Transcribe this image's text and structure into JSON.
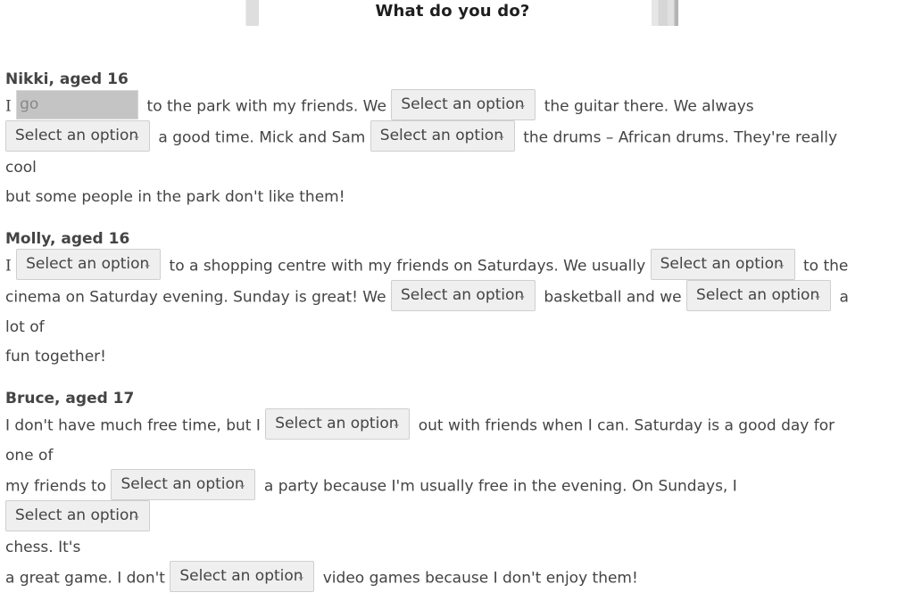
{
  "header": {
    "title": "What do you do?"
  },
  "select_placeholder": "Select an option",
  "sections": [
    {
      "name": "Nikki, aged 16",
      "parts": {
        "t0": "I",
        "input_value": "go",
        "t1": "to the park with my friends. We",
        "t2": "the guitar there. We always",
        "t3": "a good time. Mick and Sam",
        "t4": "the drums – African drums. They're really cool",
        "t5": "but some people in the park don't like them!"
      }
    },
    {
      "name": "Molly, aged 16",
      "parts": {
        "t0": "I",
        "t1": "to a shopping centre with my friends on Saturdays. We usually",
        "t2": "to the",
        "t3": "cinema on Saturday evening. Sunday is great! We",
        "t4": "basketball and we",
        "t5": "a lot of",
        "t6": "fun together!"
      }
    },
    {
      "name": "Bruce, aged 17",
      "parts": {
        "t0": "I don't have much free time, but I",
        "t1": "out with friends when I can. Saturday is a good day for one of",
        "t2": "my friends to",
        "t3": "a party because I'm usually free in the evening. On Sundays, I",
        "t4": "chess. It's",
        "t5": "a great game. I don't",
        "t6": "video games because I don't enjoy them!"
      }
    }
  ],
  "icons": {
    "select_arrow": "chevron-down-icon"
  }
}
